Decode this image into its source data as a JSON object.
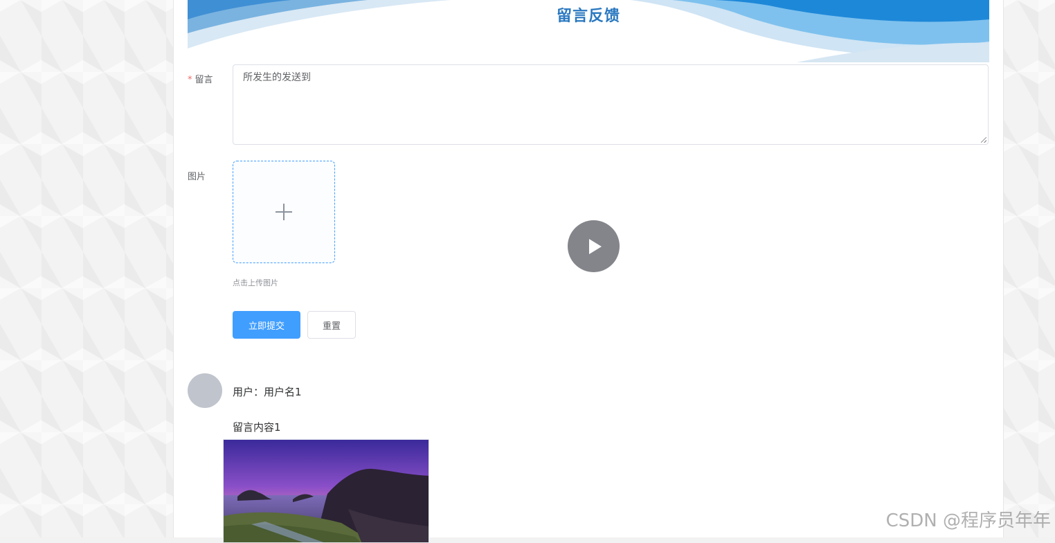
{
  "banner": {
    "title": "留言反馈"
  },
  "form": {
    "message_label": "留言",
    "required_mark": "*",
    "message_value": "所发生的发送到",
    "image_label": "图片",
    "upload_tip": "点击上传图片",
    "submit_label": "立即提交",
    "reset_label": "重置"
  },
  "comments": [
    {
      "user_text": "用户：用户名1",
      "content": "留言内容1"
    }
  ],
  "watermark": "CSDN @程序员年年",
  "colors": {
    "primary": "#409eff",
    "banner_blue": "#1e88d8",
    "title_blue": "#2a78c0"
  },
  "icons": {
    "upload": "plus-icon",
    "overlay": "play-icon"
  }
}
